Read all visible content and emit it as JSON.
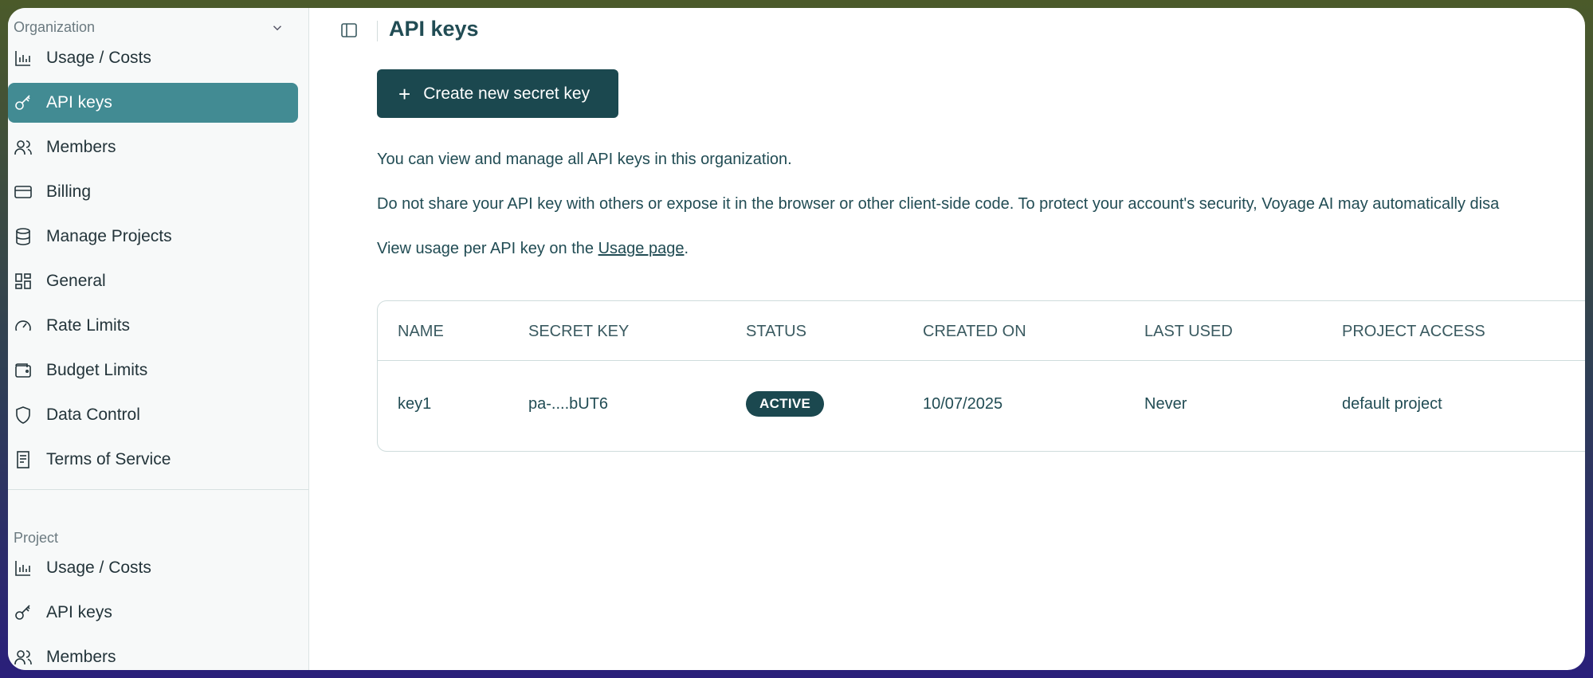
{
  "sidebar": {
    "organization": {
      "header": "Organization",
      "items": [
        {
          "label": "Usage / Costs",
          "icon": "bar-chart-icon"
        },
        {
          "label": "API keys",
          "icon": "key-icon",
          "active": true
        },
        {
          "label": "Members",
          "icon": "users-icon"
        },
        {
          "label": "Billing",
          "icon": "credit-card-icon"
        },
        {
          "label": "Manage Projects",
          "icon": "database-icon"
        },
        {
          "label": "General",
          "icon": "dashboard-icon"
        },
        {
          "label": "Rate Limits",
          "icon": "gauge-icon"
        },
        {
          "label": "Budget Limits",
          "icon": "wallet-icon"
        },
        {
          "label": "Data Control",
          "icon": "shield-icon"
        },
        {
          "label": "Terms of Service",
          "icon": "document-icon"
        }
      ]
    },
    "project": {
      "header": "Project",
      "items": [
        {
          "label": "Usage / Costs",
          "icon": "bar-chart-icon"
        },
        {
          "label": "API keys",
          "icon": "key-icon"
        },
        {
          "label": "Members",
          "icon": "users-icon"
        }
      ]
    }
  },
  "main": {
    "title": "API keys",
    "create_button": "Create new secret key",
    "info_1": "You can view and manage all API keys in this organization.",
    "info_2": "Do not share your API key with others or expose it in the browser or other client-side code. To protect your account's security, Voyage AI may automatically disa",
    "info_3_prefix": "View usage per API key on the ",
    "info_3_link": "Usage page",
    "info_3_suffix": ".",
    "table": {
      "columns": [
        "NAME",
        "SECRET KEY",
        "STATUS",
        "CREATED ON",
        "LAST USED",
        "PROJECT ACCESS"
      ],
      "rows": [
        {
          "name": "key1",
          "secret": "pa-....bUT6",
          "status": "ACTIVE",
          "created": "10/07/2025",
          "last_used": "Never",
          "project": "default project"
        }
      ]
    }
  },
  "colors": {
    "accent": "#428b93",
    "primary_dark": "#1b484f",
    "text": "#214c54"
  }
}
